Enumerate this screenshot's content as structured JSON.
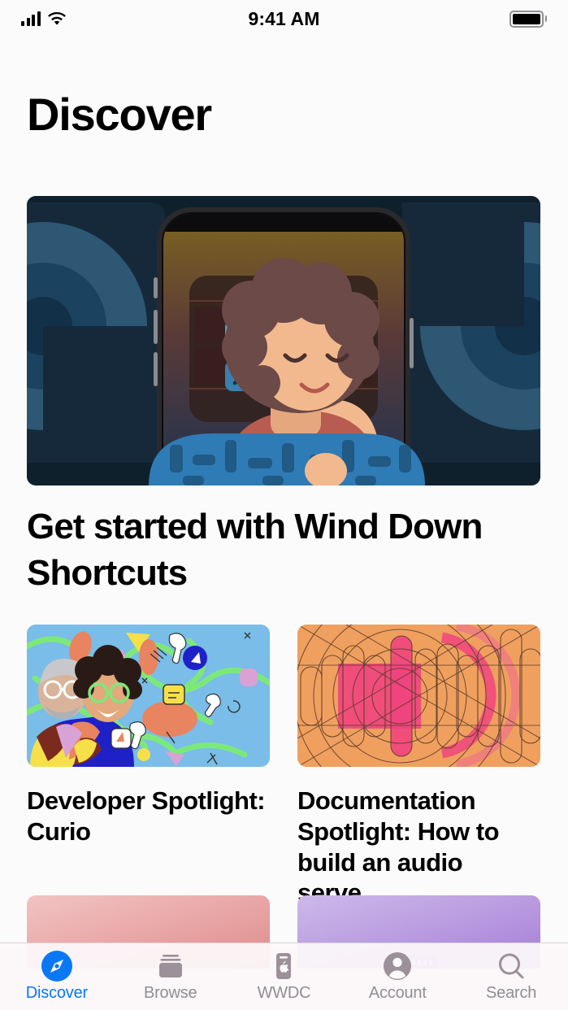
{
  "status_bar": {
    "time": "9:41 AM",
    "signal_icon": "cellular-bars-icon",
    "wifi_icon": "wifi-icon",
    "battery_icon": "battery-full-icon"
  },
  "header": {
    "title": "Discover"
  },
  "hero": {
    "title": "Get started with Wind Down Shortcuts",
    "image_name": "wind-down-shortcuts-illustration",
    "colors": {
      "background": "#0f202d",
      "panel": "#15293a",
      "circle_outer": "#2d5773",
      "circle_mid": "#1c4763",
      "circle_inner": "#12293a",
      "phone_frame": "#2a2a2c",
      "screen_top": "#7d6420",
      "screen_bottom": "#1e3350",
      "skin": "#f3b98e",
      "hair": "#6b4a47",
      "shirt": "#b85c52",
      "blanket": "#2f7bb5",
      "shortcut_icon": "#4b9ad6"
    }
  },
  "cards": [
    {
      "title": "Developer Spotlight: Curio",
      "image_name": "curio-developer-collage",
      "colors": {
        "background": "#79bde8",
        "squiggle": "#7de87a",
        "blob_orange": "#e8845f",
        "blob_pink": "#d9a2d4",
        "blob_yellow": "#f5e04a",
        "blob_blue": "#2020c8",
        "white": "#ffffff"
      }
    },
    {
      "title": "Documentation Spotlight: How to build an audio serve...",
      "image_name": "audio-server-geometric-artwork",
      "colors": {
        "background": "#f0a05e",
        "accent_pink": "#f0447e",
        "accent_rose": "#ef6d8e",
        "line": "#5a3a2a"
      }
    },
    {
      "title": "",
      "image_name": "pink-gradient-card",
      "colors": {
        "from": "#f0bcbc",
        "to": "#e08f8f"
      }
    },
    {
      "title": "",
      "image_name": "purple-gradient-card",
      "colors": {
        "from": "#cbb6e8",
        "to": "#a77fd6",
        "badge": "#9b6fd0"
      }
    }
  ],
  "tabbar": {
    "active_color": "#0a78f5",
    "inactive_color": "#8e8e93",
    "items": [
      {
        "label": "Discover",
        "icon": "compass-icon",
        "active": true
      },
      {
        "label": "Browse",
        "icon": "documents-stack-icon",
        "active": false
      },
      {
        "label": "WWDC",
        "icon": "apple-badge-icon",
        "active": false
      },
      {
        "label": "Account",
        "icon": "person-circle-icon",
        "active": false
      },
      {
        "label": "Search",
        "icon": "magnifier-icon",
        "active": false
      }
    ]
  }
}
